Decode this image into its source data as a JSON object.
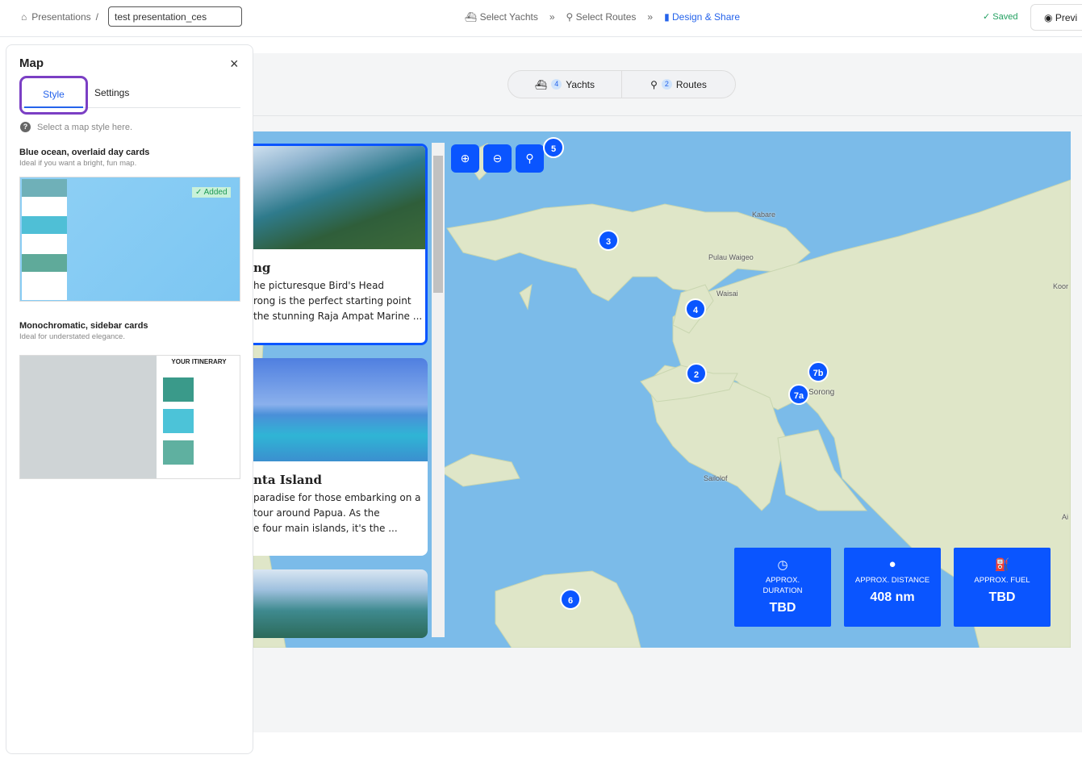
{
  "header": {
    "breadcrumb_root": "Presentations",
    "breadcrumb_sep": "/",
    "title_value": "test presentation_ces",
    "steps": [
      {
        "label": "Select Yachts"
      },
      {
        "label": "Select Routes"
      },
      {
        "label": "Design & Share"
      }
    ],
    "step_sep": "»",
    "saved": "✓ Saved",
    "preview": "Previ"
  },
  "toolbar": {
    "yachts_count": "4",
    "yachts_label": "Yachts",
    "routes_count": "2",
    "routes_label": "Routes"
  },
  "panel": {
    "title": "Map",
    "tabs": [
      "Style",
      "Settings"
    ],
    "active_tab": "Style",
    "hint": "Select a map style here.",
    "styles": [
      {
        "name": "Blue ocean, overlaid day cards",
        "desc": "Ideal if you want a bright, fun map.",
        "badge": "✓ Added"
      },
      {
        "name": "Monochromatic, sidebar cards",
        "desc": "Ideal for understated elegance.",
        "preview_heading": "YOUR ITINERARY"
      }
    ]
  },
  "cards": [
    {
      "title": "ng",
      "lines": [
        "he picturesque Bird's Head",
        "rong is the perfect starting point",
        "the stunning Raja Ampat Marine ..."
      ]
    },
    {
      "title": "nta Island",
      "lines": [
        "paradise for those embarking on a",
        "tour around Papua. As the",
        "e four main islands, it's the ..."
      ]
    }
  ],
  "map": {
    "markers": [
      "5",
      "3",
      "4",
      "2",
      "7b",
      "7a",
      "6"
    ],
    "places": [
      "Kabare",
      "Pulau Waigeo",
      "Waisai",
      "Koor",
      "Sorong",
      "Sailolof",
      "Ai"
    ],
    "ocean_color": "#7bbbe9",
    "land_color": "#dfe6c8",
    "accent": "#0a55ff"
  },
  "stats": [
    {
      "label": "APPROX. DURATION",
      "value": "TBD",
      "icon": "clock-icon"
    },
    {
      "label": "APPROX. DISTANCE",
      "value": "408 nm",
      "icon": "pin-icon"
    },
    {
      "label": "APPROX. FUEL",
      "value": "TBD",
      "icon": "fuel-icon"
    }
  ]
}
